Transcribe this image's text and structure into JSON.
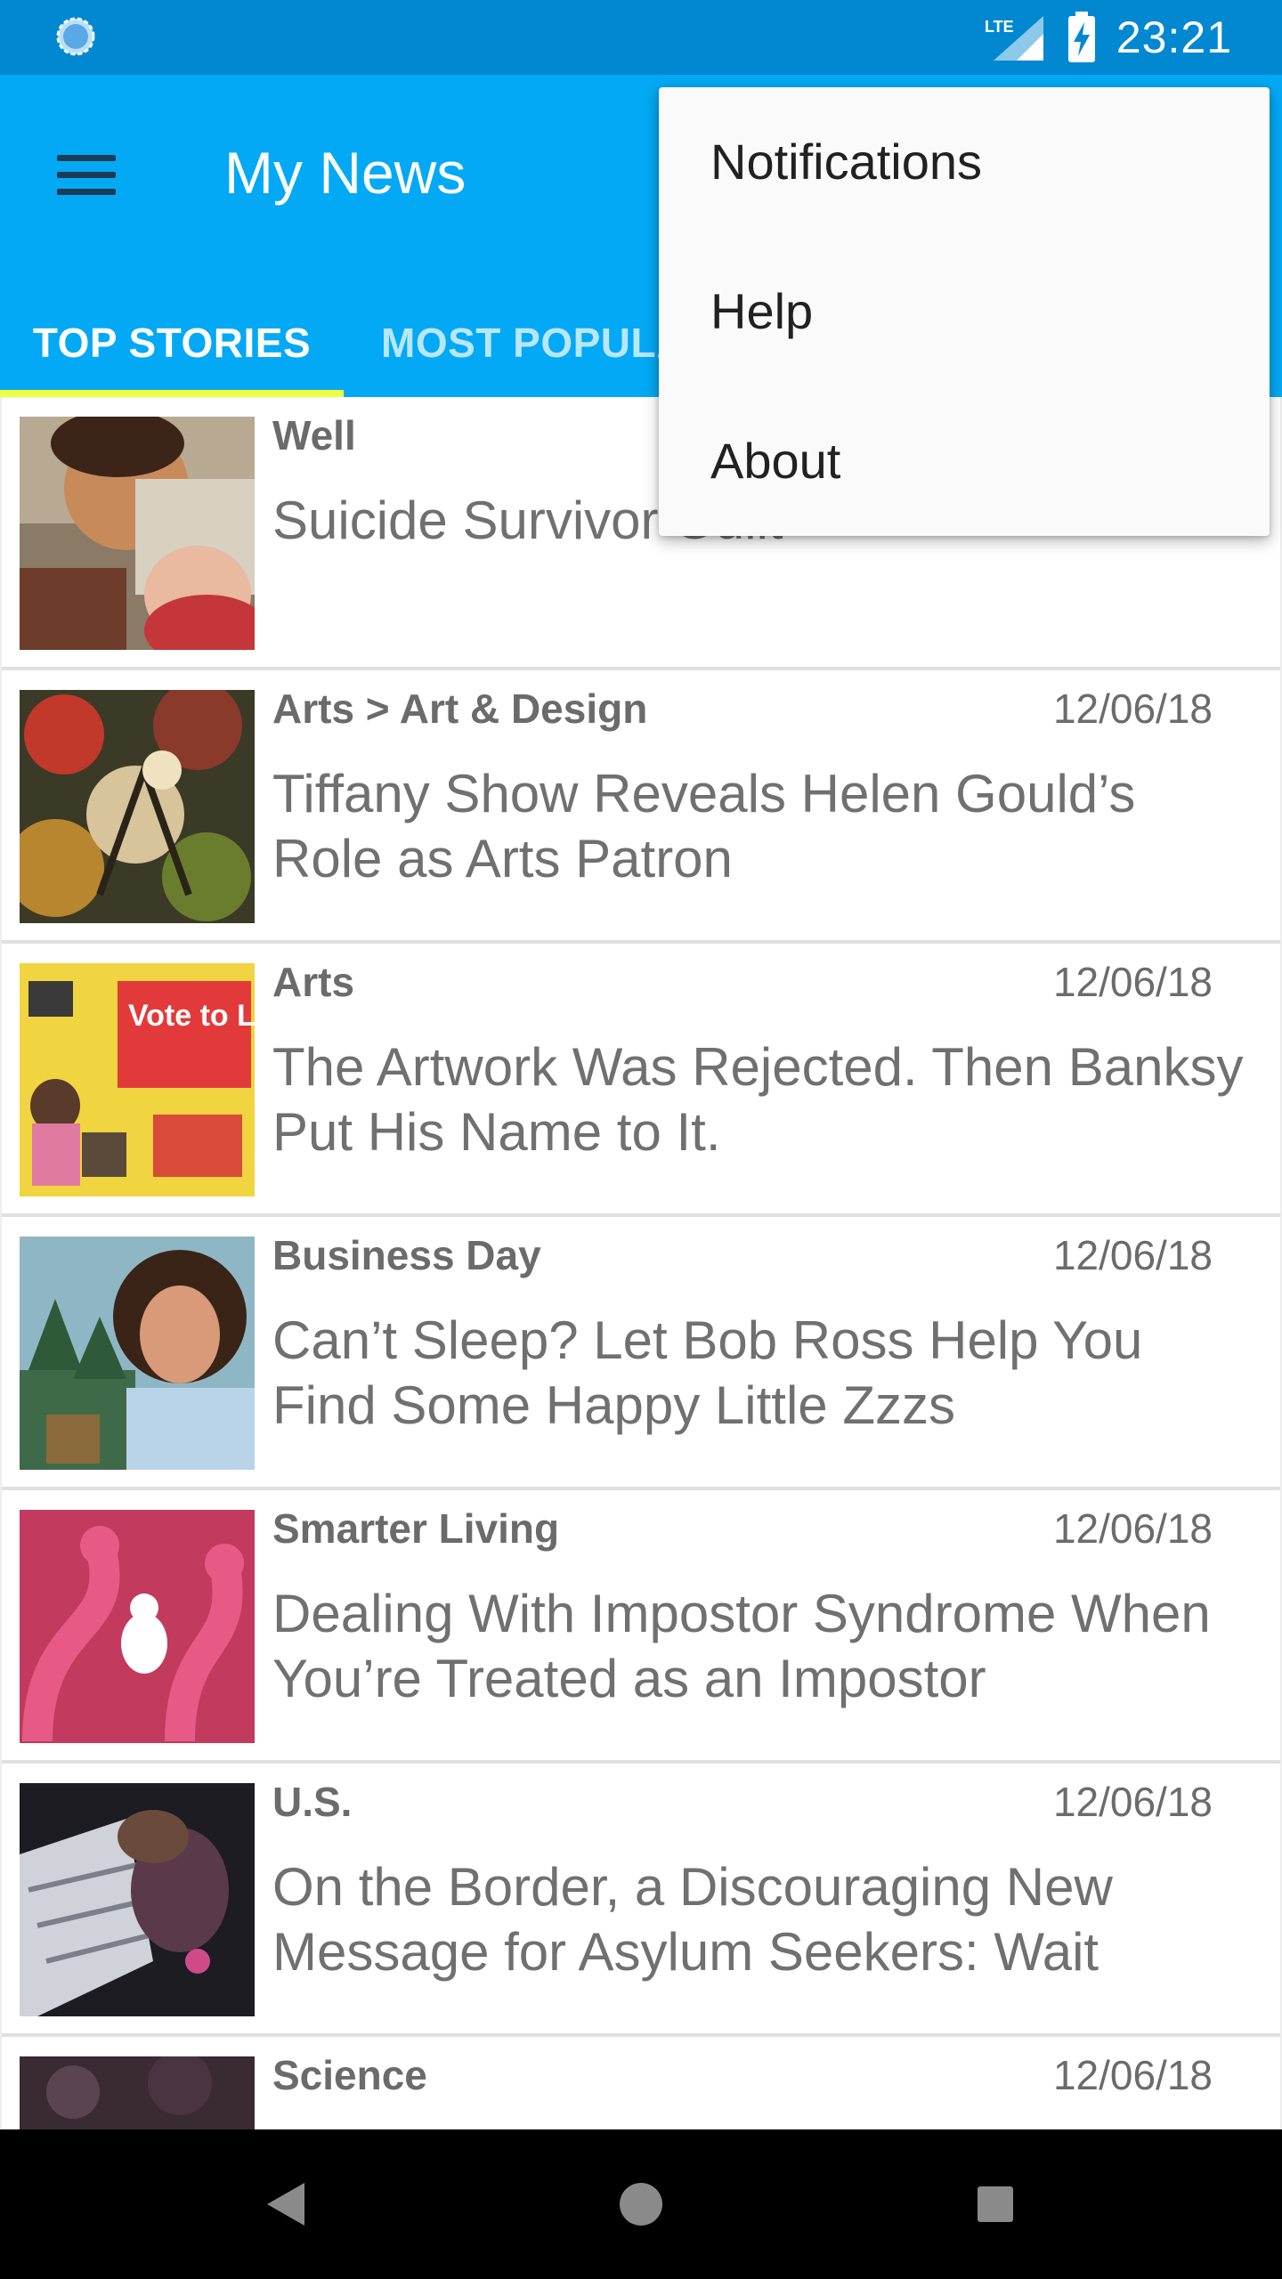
{
  "status_bar": {
    "time": "23:21",
    "network_label": "LTE",
    "icons": [
      "sync-icon",
      "signal-icon",
      "battery-charging-icon"
    ]
  },
  "app_bar": {
    "title": "My News",
    "menu_icon": "hamburger-menu-icon",
    "bg_color": "#03a9f4",
    "status_color": "#0288d1",
    "indicator_color": "#eeff41"
  },
  "tabs": [
    {
      "label": "TOP STORIES",
      "active": true
    },
    {
      "label": "MOST POPULA",
      "active": false
    }
  ],
  "overflow_menu": {
    "items": [
      {
        "label": "Notifications"
      },
      {
        "label": "Help"
      },
      {
        "label": "About"
      }
    ]
  },
  "articles": [
    {
      "section": "Well",
      "date": "",
      "headline": "Suicide Survivor Guilt"
    },
    {
      "section": "Arts > Art & Design",
      "date": "12/06/18",
      "headline": "Tiffany Show Reveals Helen Gould’s Role as Arts Patron"
    },
    {
      "section": "Arts",
      "date": "12/06/18",
      "headline": "The Artwork Was Rejected. Then Banksy Put His Name to It."
    },
    {
      "section": "Business Day",
      "date": "12/06/18",
      "headline": "Can’t Sleep? Let Bob Ross Help You Find Some Happy Little Zzzs"
    },
    {
      "section": "Smarter Living",
      "date": "12/06/18",
      "headline": "Dealing With Impostor Syndrome When You’re Treated as an Impostor"
    },
    {
      "section": "U.S.",
      "date": "12/06/18",
      "headline": "On the Border, a Discouraging New Message for Asylum Seekers: Wait"
    },
    {
      "section": "Science",
      "date": "12/06/18",
      "headline": ""
    }
  ],
  "thumb_text": {
    "vote_poster": "Vote to Love"
  },
  "nav_bar": {
    "icons": [
      "back-icon",
      "home-icon",
      "recents-icon"
    ]
  }
}
